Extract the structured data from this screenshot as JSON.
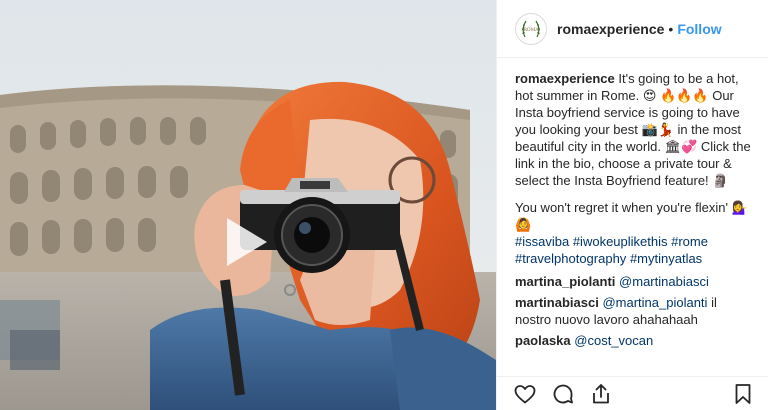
{
  "post": {
    "owner": "romaexperience",
    "avatar_text": "ROMA",
    "follow_label": "Follow",
    "separator": "•",
    "caption_user": "romaexperience",
    "caption_text": "It's going to be a hot, hot summer in Rome. 😍 🔥🔥🔥 Our Insta boyfriend service is going to have you looking your best 📸💃 in the most beautiful city in the world. 🏛💞 Click the link in the bio, choose a private tour & select the Insta Boyfriend feature! 🗿",
    "caption_line2": "You won't regret it when you're flexin' 💁‍♀️🙆",
    "hashtags": [
      "#issaviba",
      "#iwokeuplikethis",
      "#rome",
      "#travelphotography",
      "#mytinyatlas"
    ]
  },
  "comments": [
    {
      "user": "martina_piolanti",
      "mention": "@martinabiasci",
      "text": ""
    },
    {
      "user": "martinabiasci",
      "mention": "@martina_piolanti",
      "text": "il nostro nuovo lavoro ahahahaah"
    },
    {
      "user": "paolaska",
      "mention": "@cost_vocan",
      "text": ""
    }
  ],
  "icons": {
    "like": "heart-icon",
    "comment": "comment-icon",
    "share": "share-icon",
    "save": "bookmark-icon",
    "play": "play-icon"
  },
  "colors": {
    "link": "#3897f0",
    "hashtag": "#003569",
    "text": "#262626",
    "hair": "#e0602a"
  }
}
